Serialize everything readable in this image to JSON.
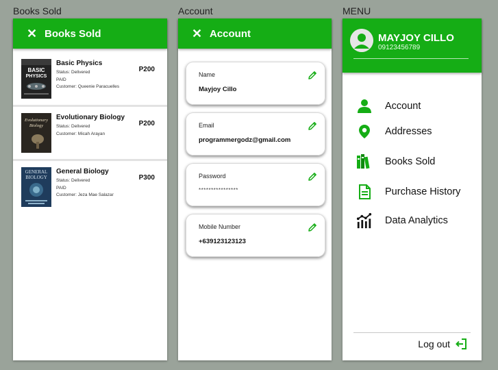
{
  "frames": {
    "books_sold_label": "Books Sold",
    "account_label": "Account",
    "menu_label": "MENU"
  },
  "books_panel": {
    "title": "Books Sold",
    "books": [
      {
        "cover_text": "BASIC PHYSICS",
        "title": "Basic Physics",
        "status": "Status: Delivered",
        "payment": "PAID",
        "customer": "Customer: Queenie Paracuelles",
        "price": "P200"
      },
      {
        "cover_text": "Evolutionary Biology",
        "title": "Evolutionary Biology",
        "status": "Status: Delivered",
        "payment": "",
        "customer": "Customer: Micah Arayan",
        "price": "P200"
      },
      {
        "cover_text": "GENERAL BIOLOGY",
        "title": "General Biology",
        "status": "Status: Delivered",
        "payment": "PAID",
        "customer": "Customer: Jeza Mae Salazar",
        "price": "P300"
      }
    ]
  },
  "account_panel": {
    "title": "Account",
    "fields": [
      {
        "label": "Name",
        "value": "Mayjoy Cillo"
      },
      {
        "label": "Email",
        "value": "programmergodz@gmail.com"
      },
      {
        "label": "Password",
        "value": "****************"
      },
      {
        "label": "Mobile Number",
        "value": "+639123123123"
      }
    ]
  },
  "menu_panel": {
    "user_name": "MAYJOY CILLO",
    "user_phone": "09123456789",
    "items": [
      {
        "label": "Account",
        "icon": "person-icon"
      },
      {
        "label": "Addresses",
        "icon": "location-pin-icon"
      },
      {
        "label": "Books Sold",
        "icon": "books-icon"
      },
      {
        "label": "Purchase History",
        "icon": "receipt-icon"
      },
      {
        "label": "Data Analytics",
        "icon": "analytics-icon"
      }
    ],
    "logout_label": "Log out",
    "logout_icon": "logout-icon"
  },
  "colors": {
    "brand_green": "#15ad15",
    "background": "#9aa39a"
  }
}
